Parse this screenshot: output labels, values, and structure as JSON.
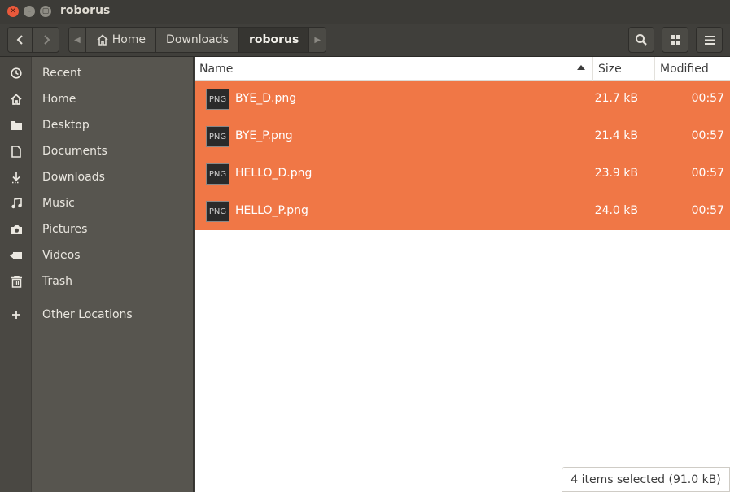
{
  "window": {
    "title": "roborus",
    "buttons": [
      "close-icon",
      "minimize-icon",
      "maximize-icon"
    ]
  },
  "header": {
    "back_icon": "chevron-left-icon",
    "forward_icon": "chevron-right-icon",
    "breadcrumb": [
      {
        "label": "Home",
        "icon": "home-icon"
      },
      {
        "label": "Downloads"
      },
      {
        "label": "roborus",
        "active": true
      }
    ],
    "tools": [
      "search-icon",
      "grid-view-icon",
      "menu-icon"
    ]
  },
  "sidebar": {
    "items": [
      {
        "label": "Recent",
        "icon": "clock-icon"
      },
      {
        "label": "Home",
        "icon": "home-icon"
      },
      {
        "label": "Desktop",
        "icon": "folder-icon"
      },
      {
        "label": "Documents",
        "icon": "document-icon"
      },
      {
        "label": "Downloads",
        "icon": "download-icon"
      },
      {
        "label": "Music",
        "icon": "music-icon"
      },
      {
        "label": "Pictures",
        "icon": "camera-icon"
      },
      {
        "label": "Videos",
        "icon": "video-icon"
      },
      {
        "label": "Trash",
        "icon": "trash-icon"
      },
      {
        "label": "Other Locations",
        "icon": "plus-icon"
      }
    ]
  },
  "list": {
    "columns": {
      "name": "Name",
      "size": "Size",
      "modified": "Modified"
    },
    "sort": "name-ascending",
    "files": [
      {
        "name": "BYE_D.png",
        "size": "21.7 kB",
        "modified": "00:57",
        "type": "PNG",
        "selected": true
      },
      {
        "name": "BYE_P.png",
        "size": "21.4 kB",
        "modified": "00:57",
        "type": "PNG",
        "selected": true
      },
      {
        "name": "HELLO_D.png",
        "size": "23.9 kB",
        "modified": "00:57",
        "type": "PNG",
        "selected": true
      },
      {
        "name": "HELLO_P.png",
        "size": "24.0 kB",
        "modified": "00:57",
        "type": "PNG",
        "selected": true
      }
    ]
  },
  "status": {
    "text": "4 items selected  (91.0 kB)"
  },
  "colors": {
    "selection": "#f07746",
    "sidebar": "#57554f",
    "titlebar": "#3c3b37"
  }
}
